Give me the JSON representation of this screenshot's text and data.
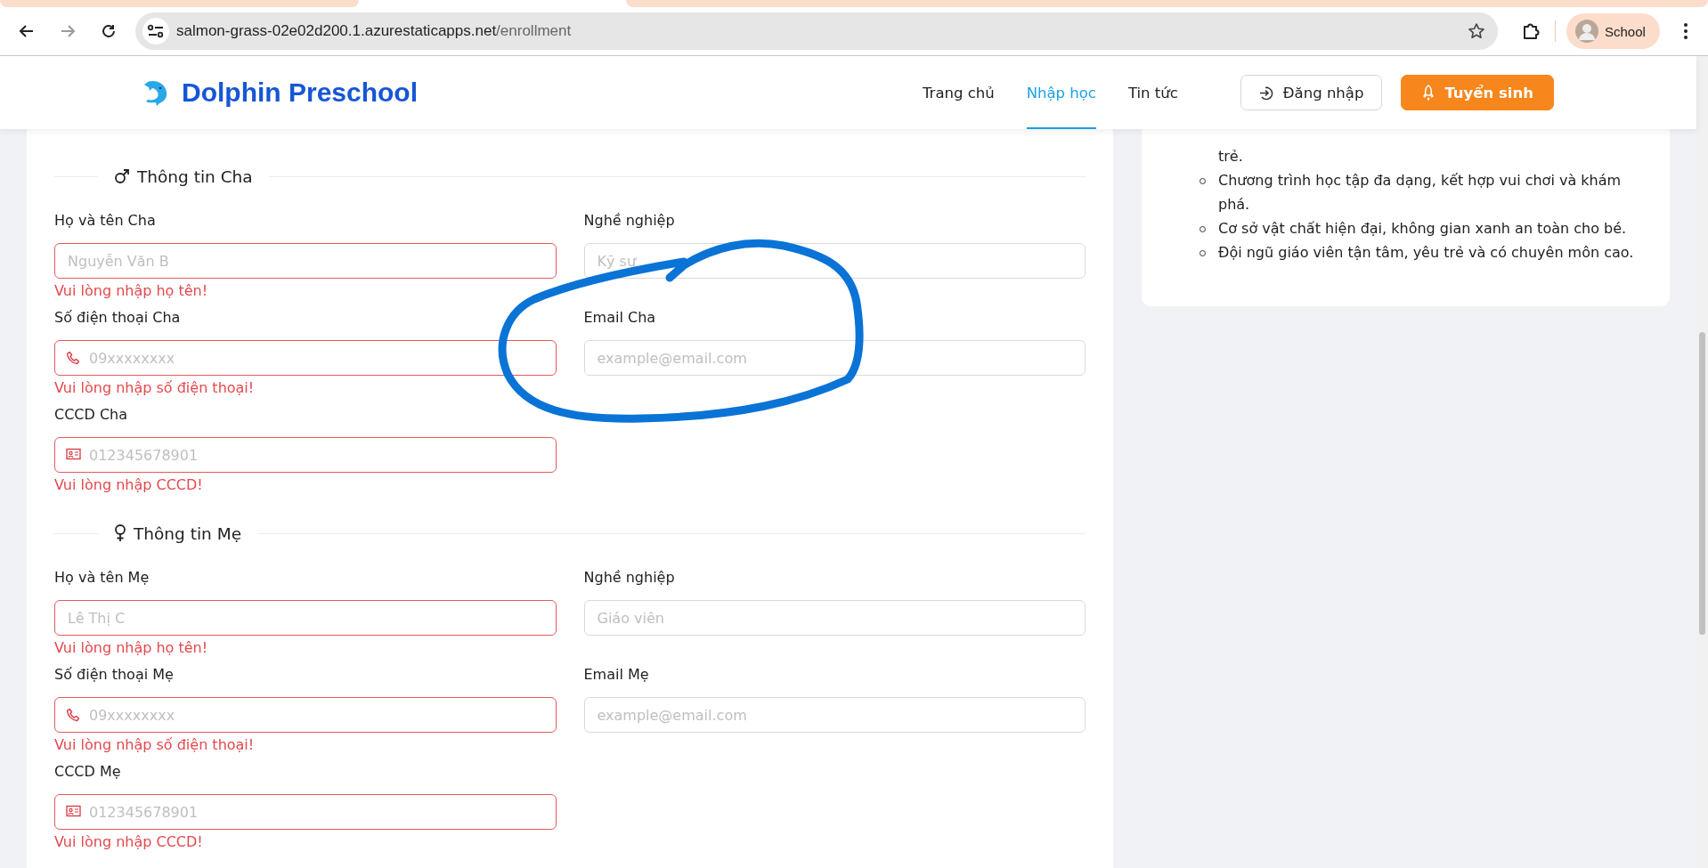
{
  "browser": {
    "url_host": "salmon-grass-02e02d200.1.azurestaticapps.net",
    "url_path": "/enrollment",
    "profile": "School"
  },
  "header": {
    "brand": "Dolphin Preschool",
    "nav": [
      {
        "label": "Trang chủ",
        "selected": false
      },
      {
        "label": "Nhập học",
        "selected": true
      },
      {
        "label": "Tin tức",
        "selected": false
      }
    ],
    "login_button": "Đăng nhập",
    "enroll_button": "Tuyển sinh"
  },
  "form": {
    "sections": [
      {
        "title": "Thông tin Cha",
        "kind": "male",
        "fields": [
          {
            "label": "Họ và tên Cha",
            "placeholder": "Nguyễn Văn B",
            "kind": "text",
            "invalid": true,
            "error": "Vui lòng nhập họ tên!"
          },
          {
            "label": "Nghề nghiệp",
            "placeholder": "Kỹ sư",
            "kind": "text",
            "invalid": false
          },
          {
            "label": "Số điện thoại Cha",
            "placeholder": "09xxxxxxxx",
            "kind": "phone",
            "invalid": true,
            "error": "Vui lòng nhập số điện thoại!"
          },
          {
            "label": "Email Cha",
            "placeholder": "example@email.com",
            "kind": "text",
            "invalid": false
          },
          {
            "label": "CCCD Cha",
            "placeholder": "012345678901",
            "kind": "id-card",
            "invalid": true,
            "error": "Vui lòng nhập CCCD!"
          }
        ]
      },
      {
        "title": "Thông tin Mẹ",
        "kind": "female",
        "fields": [
          {
            "label": "Họ và tên Mẹ",
            "placeholder": "Lê Thị C",
            "kind": "text",
            "invalid": true,
            "error": "Vui lòng nhập họ tên!"
          },
          {
            "label": "Nghề nghiệp",
            "placeholder": "Giáo viên",
            "kind": "text",
            "invalid": false
          },
          {
            "label": "Số điện thoại Mẹ",
            "placeholder": "09xxxxxxxx",
            "kind": "phone",
            "invalid": true,
            "error": "Vui lòng nhập số điện thoại!"
          },
          {
            "label": "Email Mẹ",
            "placeholder": "example@email.com",
            "kind": "text",
            "invalid": false
          },
          {
            "label": "CCCD Mẹ",
            "placeholder": "012345678901",
            "kind": "id-card",
            "invalid": true,
            "error": "Vui lòng nhập CCCD!"
          }
        ]
      }
    ]
  },
  "sidebar": {
    "bullets": [
      {
        "text": "trẻ.",
        "continued": true
      },
      {
        "text": "Chương trình học tập đa dạng, kết hợp vui chơi và khám phá.",
        "continued": false
      },
      {
        "text": "Cơ sở vật chất hiện đại, không gian xanh an toàn cho bé.",
        "continued": false
      },
      {
        "text": "Đội ngũ giáo viên tận tâm, yêu trẻ và có chuyên môn cao.",
        "continued": false
      }
    ]
  }
}
